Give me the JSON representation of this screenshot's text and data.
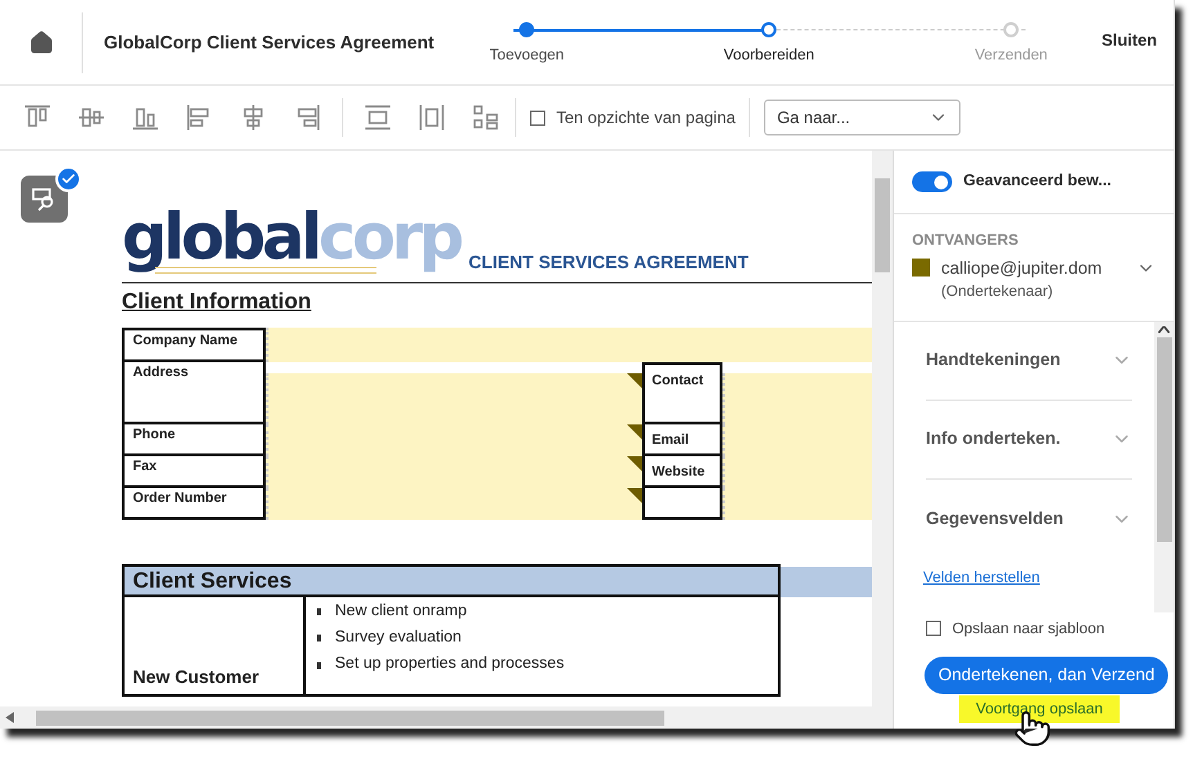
{
  "header": {
    "title": "GlobalCorp Client Services Agreement",
    "close": "Sluiten",
    "steps": [
      {
        "label": "Toevoegen",
        "completed": true,
        "selected": false
      },
      {
        "label": "Voorbereiden",
        "completed": false,
        "selected": true
      },
      {
        "label": "Verzenden",
        "completed": false,
        "selected": false
      }
    ]
  },
  "toolbar": {
    "relative_to_page": {
      "label": "Ten opzichte van pagina",
      "checked": false
    },
    "goto": {
      "value": "Ga naar..."
    }
  },
  "document": {
    "logo": {
      "part_1": "global",
      "part_2": "corp"
    },
    "heading": "CLIENT SERVICES AGREEMENT",
    "section_title": "Client Information",
    "rows": [
      {
        "label": "Company Name",
        "right_label": null,
        "flagged": false
      },
      {
        "label": "Address",
        "right_label": "Contact",
        "flagged": true
      },
      {
        "label": "Phone",
        "right_label": "Email",
        "flagged": true
      },
      {
        "label": "Fax",
        "right_label": "Website",
        "flagged": true
      },
      {
        "label": "Order Number",
        "right_label": "",
        "flagged": true
      }
    ],
    "services": {
      "title": "Client Services",
      "row_label": "New Customer",
      "items": [
        "New client onramp",
        "Survey evaluation",
        "Set up properties and processes"
      ]
    }
  },
  "panel": {
    "advanced": {
      "label": "Geavanceerd bew...",
      "on": true
    },
    "recipients_title": "ONTVANGERS",
    "recipients": [
      {
        "email": "calliope@jupiter.dom",
        "role": "(Ondertekenaar)",
        "color": "#7a6a00"
      }
    ],
    "sections": [
      {
        "label": "Handtekeningen",
        "expanded": false
      },
      {
        "label": "Info onderteken.",
        "expanded": false
      },
      {
        "label": "Gegevensvelden",
        "expanded": false
      }
    ],
    "reset_link": "Velden herstellen",
    "save_template": {
      "label": "Opslaan naar sjabloon",
      "checked": false
    },
    "primary_button": "Ondertekenen, dan Verzend",
    "save_progress": "Voortgang opslaan"
  }
}
